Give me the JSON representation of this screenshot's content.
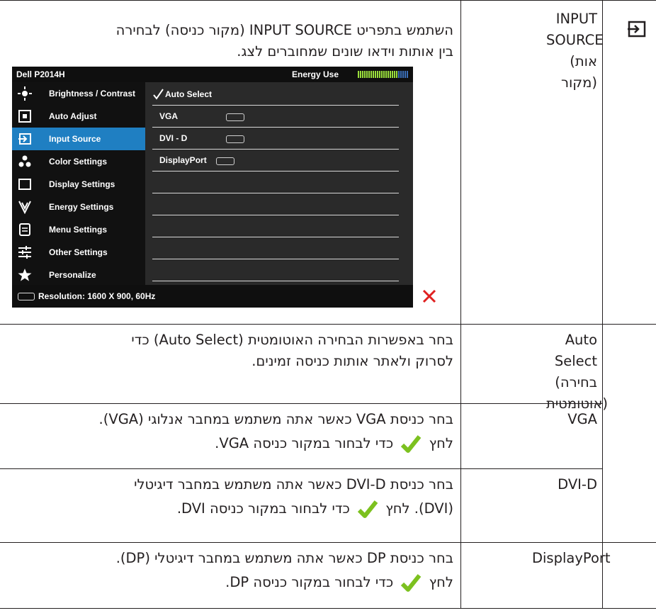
{
  "rows": [
    {
      "label": "INPUT SOURCE (אות מקור)",
      "desc_line1": "השתמש בתפריט INPUT SOURCE (מקור כניסה) לבחירה",
      "desc_line2": "בין אותות וידאו שונים שמחוברים לצג."
    },
    {
      "label": "Auto Select (בחירה אוטומטית)",
      "desc_line1": "בחר באפשרות הבחירה האוטומטית (Auto Select) כדי",
      "desc_line2": "לסרוק ולאתר אותות כניסה זמינים."
    },
    {
      "label": "VGA",
      "desc_line1": "בחר כניסת VGA כאשר אתה משתמש במחבר אנלוגי (VGA).",
      "desc_line2a": "לחץ",
      "desc_line2b": "כדי לבחור במקור כניסה VGA."
    },
    {
      "label": "DVI-D",
      "desc_line1": "בחר כניסת DVI-D כאשר אתה משתמש במחבר דיגיטלי",
      "desc_line2a": "(DVI). לחץ",
      "desc_line2b": "כדי לבחור במקור כניסה DVI."
    },
    {
      "label": "DisplayPort",
      "desc_line1": "בחר כניסת DP כאשר אתה משתמש במחבר דיגיטלי (DP).",
      "desc_line2a": "לחץ",
      "desc_line2b": "כדי לבחור במקור כניסה DP."
    }
  ],
  "osd": {
    "title": "Dell P2014H",
    "energy_label": "Energy Use",
    "energy_level_fraction": 0.8,
    "menu": [
      {
        "label": "Brightness / Contrast",
        "icon": "brightness-icon"
      },
      {
        "label": "Auto Adjust",
        "icon": "auto-adjust-icon"
      },
      {
        "label": "Input Source",
        "icon": "input-source-icon",
        "active": true
      },
      {
        "label": "Color Settings",
        "icon": "color-settings-icon"
      },
      {
        "label": "Display Settings",
        "icon": "display-settings-icon"
      },
      {
        "label": "Energy Settings",
        "icon": "energy-settings-icon"
      },
      {
        "label": "Menu Settings",
        "icon": "menu-settings-icon"
      },
      {
        "label": "Other Settings",
        "icon": "other-settings-icon"
      },
      {
        "label": "Personalize",
        "icon": "star-icon"
      }
    ],
    "options": [
      {
        "label": "Auto Select",
        "checked": true
      },
      {
        "label": "VGA"
      },
      {
        "label": "DVI - D"
      },
      {
        "label": "DisplayPort"
      }
    ],
    "footer": "Resolution: 1600 X 900, 60Hz",
    "nav": [
      "chevron-up-icon",
      "chevron-down-icon",
      "arrow-right-icon",
      "close-icon"
    ],
    "colors": {
      "active": "#1f7fc2",
      "close": "#e02020",
      "energy_on": "#9adf3c",
      "energy_off": "#3b6fb8"
    }
  },
  "colors": {
    "check": "#7cc11f",
    "rule": "#231f20"
  }
}
